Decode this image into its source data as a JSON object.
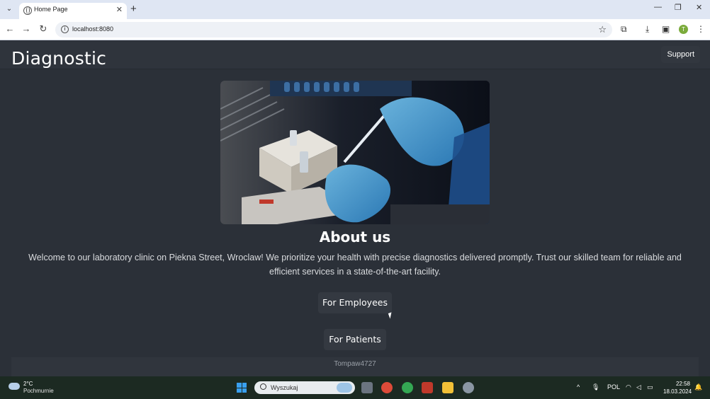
{
  "browser": {
    "tab_title": "Home Page",
    "url": "localhost:8080",
    "profile_initial": "T"
  },
  "site": {
    "brand": "Diagnostic",
    "nav_support": "Support",
    "about_title": "About us",
    "about_text_line1": "Welcome to our laboratory clinic on Piekna Street, Wroclaw! We prioritize your health with precise diagnostics delivered promptly. Trust our skilled team for reliable and",
    "about_text_line2": "efficient services in a state-of-the-art facility.",
    "btn_employees": "For Employees",
    "btn_patients": "For Patients",
    "footer": "Tompaw4727"
  },
  "taskbar": {
    "weather_temp": "2°C",
    "weather_cond": "Pochmurnie",
    "search_placeholder": "Wyszukaj",
    "language": "POL",
    "time": "22:58",
    "date": "18.03.2024"
  }
}
